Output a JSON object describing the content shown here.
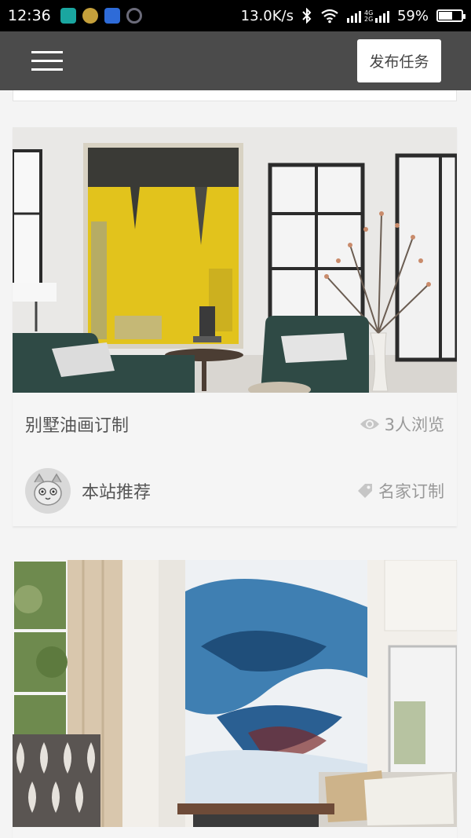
{
  "status_bar": {
    "time": "12:36",
    "net_speed": "13.0K/s",
    "network_badge": "4G 2G",
    "battery_percent": "59%",
    "battery_level": 0.59,
    "icons": [
      "app-icon-teal",
      "app-icon-gold",
      "app-icon-k",
      "app-icon-ring",
      "bluetooth-icon",
      "wifi-icon",
      "signal-icon",
      "battery-icon"
    ]
  },
  "nav": {
    "menu_icon": "hamburger-menu-icon",
    "publish_label": "发布任务"
  },
  "cards": [
    {
      "title": "别墅油画订制",
      "views": "3人浏览",
      "author": "本站推荐",
      "tag": "名家订制",
      "image": "living-room-yellow-painting",
      "colors": {
        "painting": "#e2c31c",
        "wall": "#e9e8e6",
        "sofa": "#2f4a45"
      }
    },
    {
      "image": "living-room-blue-abstract-painting",
      "colors": {
        "painting": "#3f7fb2",
        "wall": "#f2efea",
        "curtain": "#d9c7ad"
      }
    }
  ]
}
